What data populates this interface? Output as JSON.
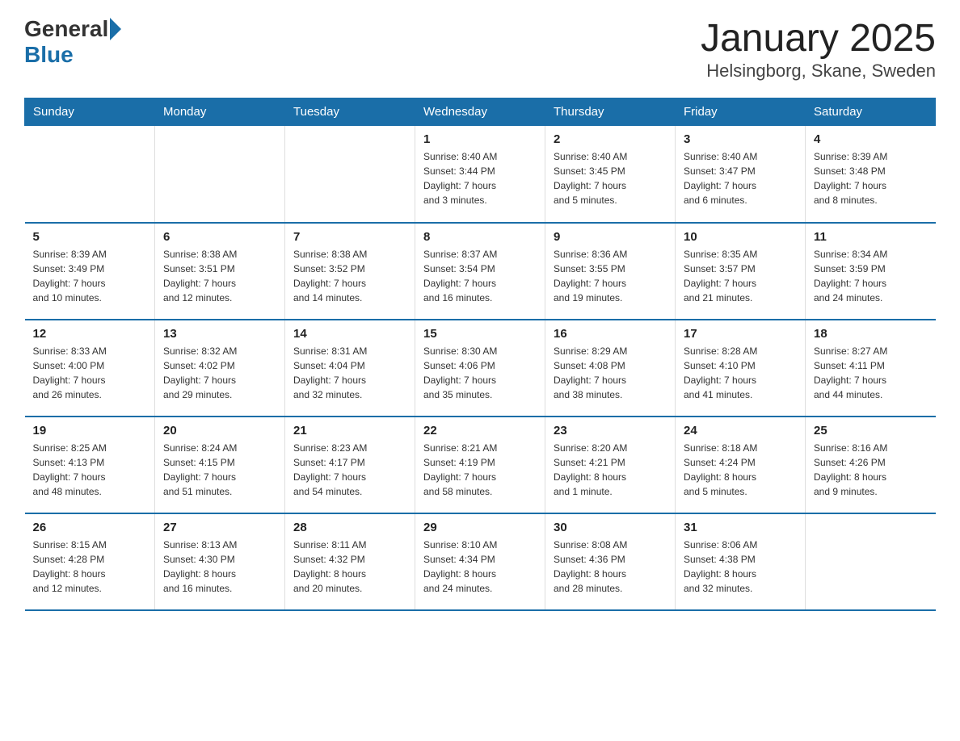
{
  "logo": {
    "general": "General",
    "blue": "Blue"
  },
  "header": {
    "title": "January 2025",
    "subtitle": "Helsingborg, Skane, Sweden"
  },
  "weekdays": [
    "Sunday",
    "Monday",
    "Tuesday",
    "Wednesday",
    "Thursday",
    "Friday",
    "Saturday"
  ],
  "weeks": [
    [
      {
        "day": "",
        "info": ""
      },
      {
        "day": "",
        "info": ""
      },
      {
        "day": "",
        "info": ""
      },
      {
        "day": "1",
        "info": "Sunrise: 8:40 AM\nSunset: 3:44 PM\nDaylight: 7 hours\nand 3 minutes."
      },
      {
        "day": "2",
        "info": "Sunrise: 8:40 AM\nSunset: 3:45 PM\nDaylight: 7 hours\nand 5 minutes."
      },
      {
        "day": "3",
        "info": "Sunrise: 8:40 AM\nSunset: 3:47 PM\nDaylight: 7 hours\nand 6 minutes."
      },
      {
        "day": "4",
        "info": "Sunrise: 8:39 AM\nSunset: 3:48 PM\nDaylight: 7 hours\nand 8 minutes."
      }
    ],
    [
      {
        "day": "5",
        "info": "Sunrise: 8:39 AM\nSunset: 3:49 PM\nDaylight: 7 hours\nand 10 minutes."
      },
      {
        "day": "6",
        "info": "Sunrise: 8:38 AM\nSunset: 3:51 PM\nDaylight: 7 hours\nand 12 minutes."
      },
      {
        "day": "7",
        "info": "Sunrise: 8:38 AM\nSunset: 3:52 PM\nDaylight: 7 hours\nand 14 minutes."
      },
      {
        "day": "8",
        "info": "Sunrise: 8:37 AM\nSunset: 3:54 PM\nDaylight: 7 hours\nand 16 minutes."
      },
      {
        "day": "9",
        "info": "Sunrise: 8:36 AM\nSunset: 3:55 PM\nDaylight: 7 hours\nand 19 minutes."
      },
      {
        "day": "10",
        "info": "Sunrise: 8:35 AM\nSunset: 3:57 PM\nDaylight: 7 hours\nand 21 minutes."
      },
      {
        "day": "11",
        "info": "Sunrise: 8:34 AM\nSunset: 3:59 PM\nDaylight: 7 hours\nand 24 minutes."
      }
    ],
    [
      {
        "day": "12",
        "info": "Sunrise: 8:33 AM\nSunset: 4:00 PM\nDaylight: 7 hours\nand 26 minutes."
      },
      {
        "day": "13",
        "info": "Sunrise: 8:32 AM\nSunset: 4:02 PM\nDaylight: 7 hours\nand 29 minutes."
      },
      {
        "day": "14",
        "info": "Sunrise: 8:31 AM\nSunset: 4:04 PM\nDaylight: 7 hours\nand 32 minutes."
      },
      {
        "day": "15",
        "info": "Sunrise: 8:30 AM\nSunset: 4:06 PM\nDaylight: 7 hours\nand 35 minutes."
      },
      {
        "day": "16",
        "info": "Sunrise: 8:29 AM\nSunset: 4:08 PM\nDaylight: 7 hours\nand 38 minutes."
      },
      {
        "day": "17",
        "info": "Sunrise: 8:28 AM\nSunset: 4:10 PM\nDaylight: 7 hours\nand 41 minutes."
      },
      {
        "day": "18",
        "info": "Sunrise: 8:27 AM\nSunset: 4:11 PM\nDaylight: 7 hours\nand 44 minutes."
      }
    ],
    [
      {
        "day": "19",
        "info": "Sunrise: 8:25 AM\nSunset: 4:13 PM\nDaylight: 7 hours\nand 48 minutes."
      },
      {
        "day": "20",
        "info": "Sunrise: 8:24 AM\nSunset: 4:15 PM\nDaylight: 7 hours\nand 51 minutes."
      },
      {
        "day": "21",
        "info": "Sunrise: 8:23 AM\nSunset: 4:17 PM\nDaylight: 7 hours\nand 54 minutes."
      },
      {
        "day": "22",
        "info": "Sunrise: 8:21 AM\nSunset: 4:19 PM\nDaylight: 7 hours\nand 58 minutes."
      },
      {
        "day": "23",
        "info": "Sunrise: 8:20 AM\nSunset: 4:21 PM\nDaylight: 8 hours\nand 1 minute."
      },
      {
        "day": "24",
        "info": "Sunrise: 8:18 AM\nSunset: 4:24 PM\nDaylight: 8 hours\nand 5 minutes."
      },
      {
        "day": "25",
        "info": "Sunrise: 8:16 AM\nSunset: 4:26 PM\nDaylight: 8 hours\nand 9 minutes."
      }
    ],
    [
      {
        "day": "26",
        "info": "Sunrise: 8:15 AM\nSunset: 4:28 PM\nDaylight: 8 hours\nand 12 minutes."
      },
      {
        "day": "27",
        "info": "Sunrise: 8:13 AM\nSunset: 4:30 PM\nDaylight: 8 hours\nand 16 minutes."
      },
      {
        "day": "28",
        "info": "Sunrise: 8:11 AM\nSunset: 4:32 PM\nDaylight: 8 hours\nand 20 minutes."
      },
      {
        "day": "29",
        "info": "Sunrise: 8:10 AM\nSunset: 4:34 PM\nDaylight: 8 hours\nand 24 minutes."
      },
      {
        "day": "30",
        "info": "Sunrise: 8:08 AM\nSunset: 4:36 PM\nDaylight: 8 hours\nand 28 minutes."
      },
      {
        "day": "31",
        "info": "Sunrise: 8:06 AM\nSunset: 4:38 PM\nDaylight: 8 hours\nand 32 minutes."
      },
      {
        "day": "",
        "info": ""
      }
    ]
  ]
}
